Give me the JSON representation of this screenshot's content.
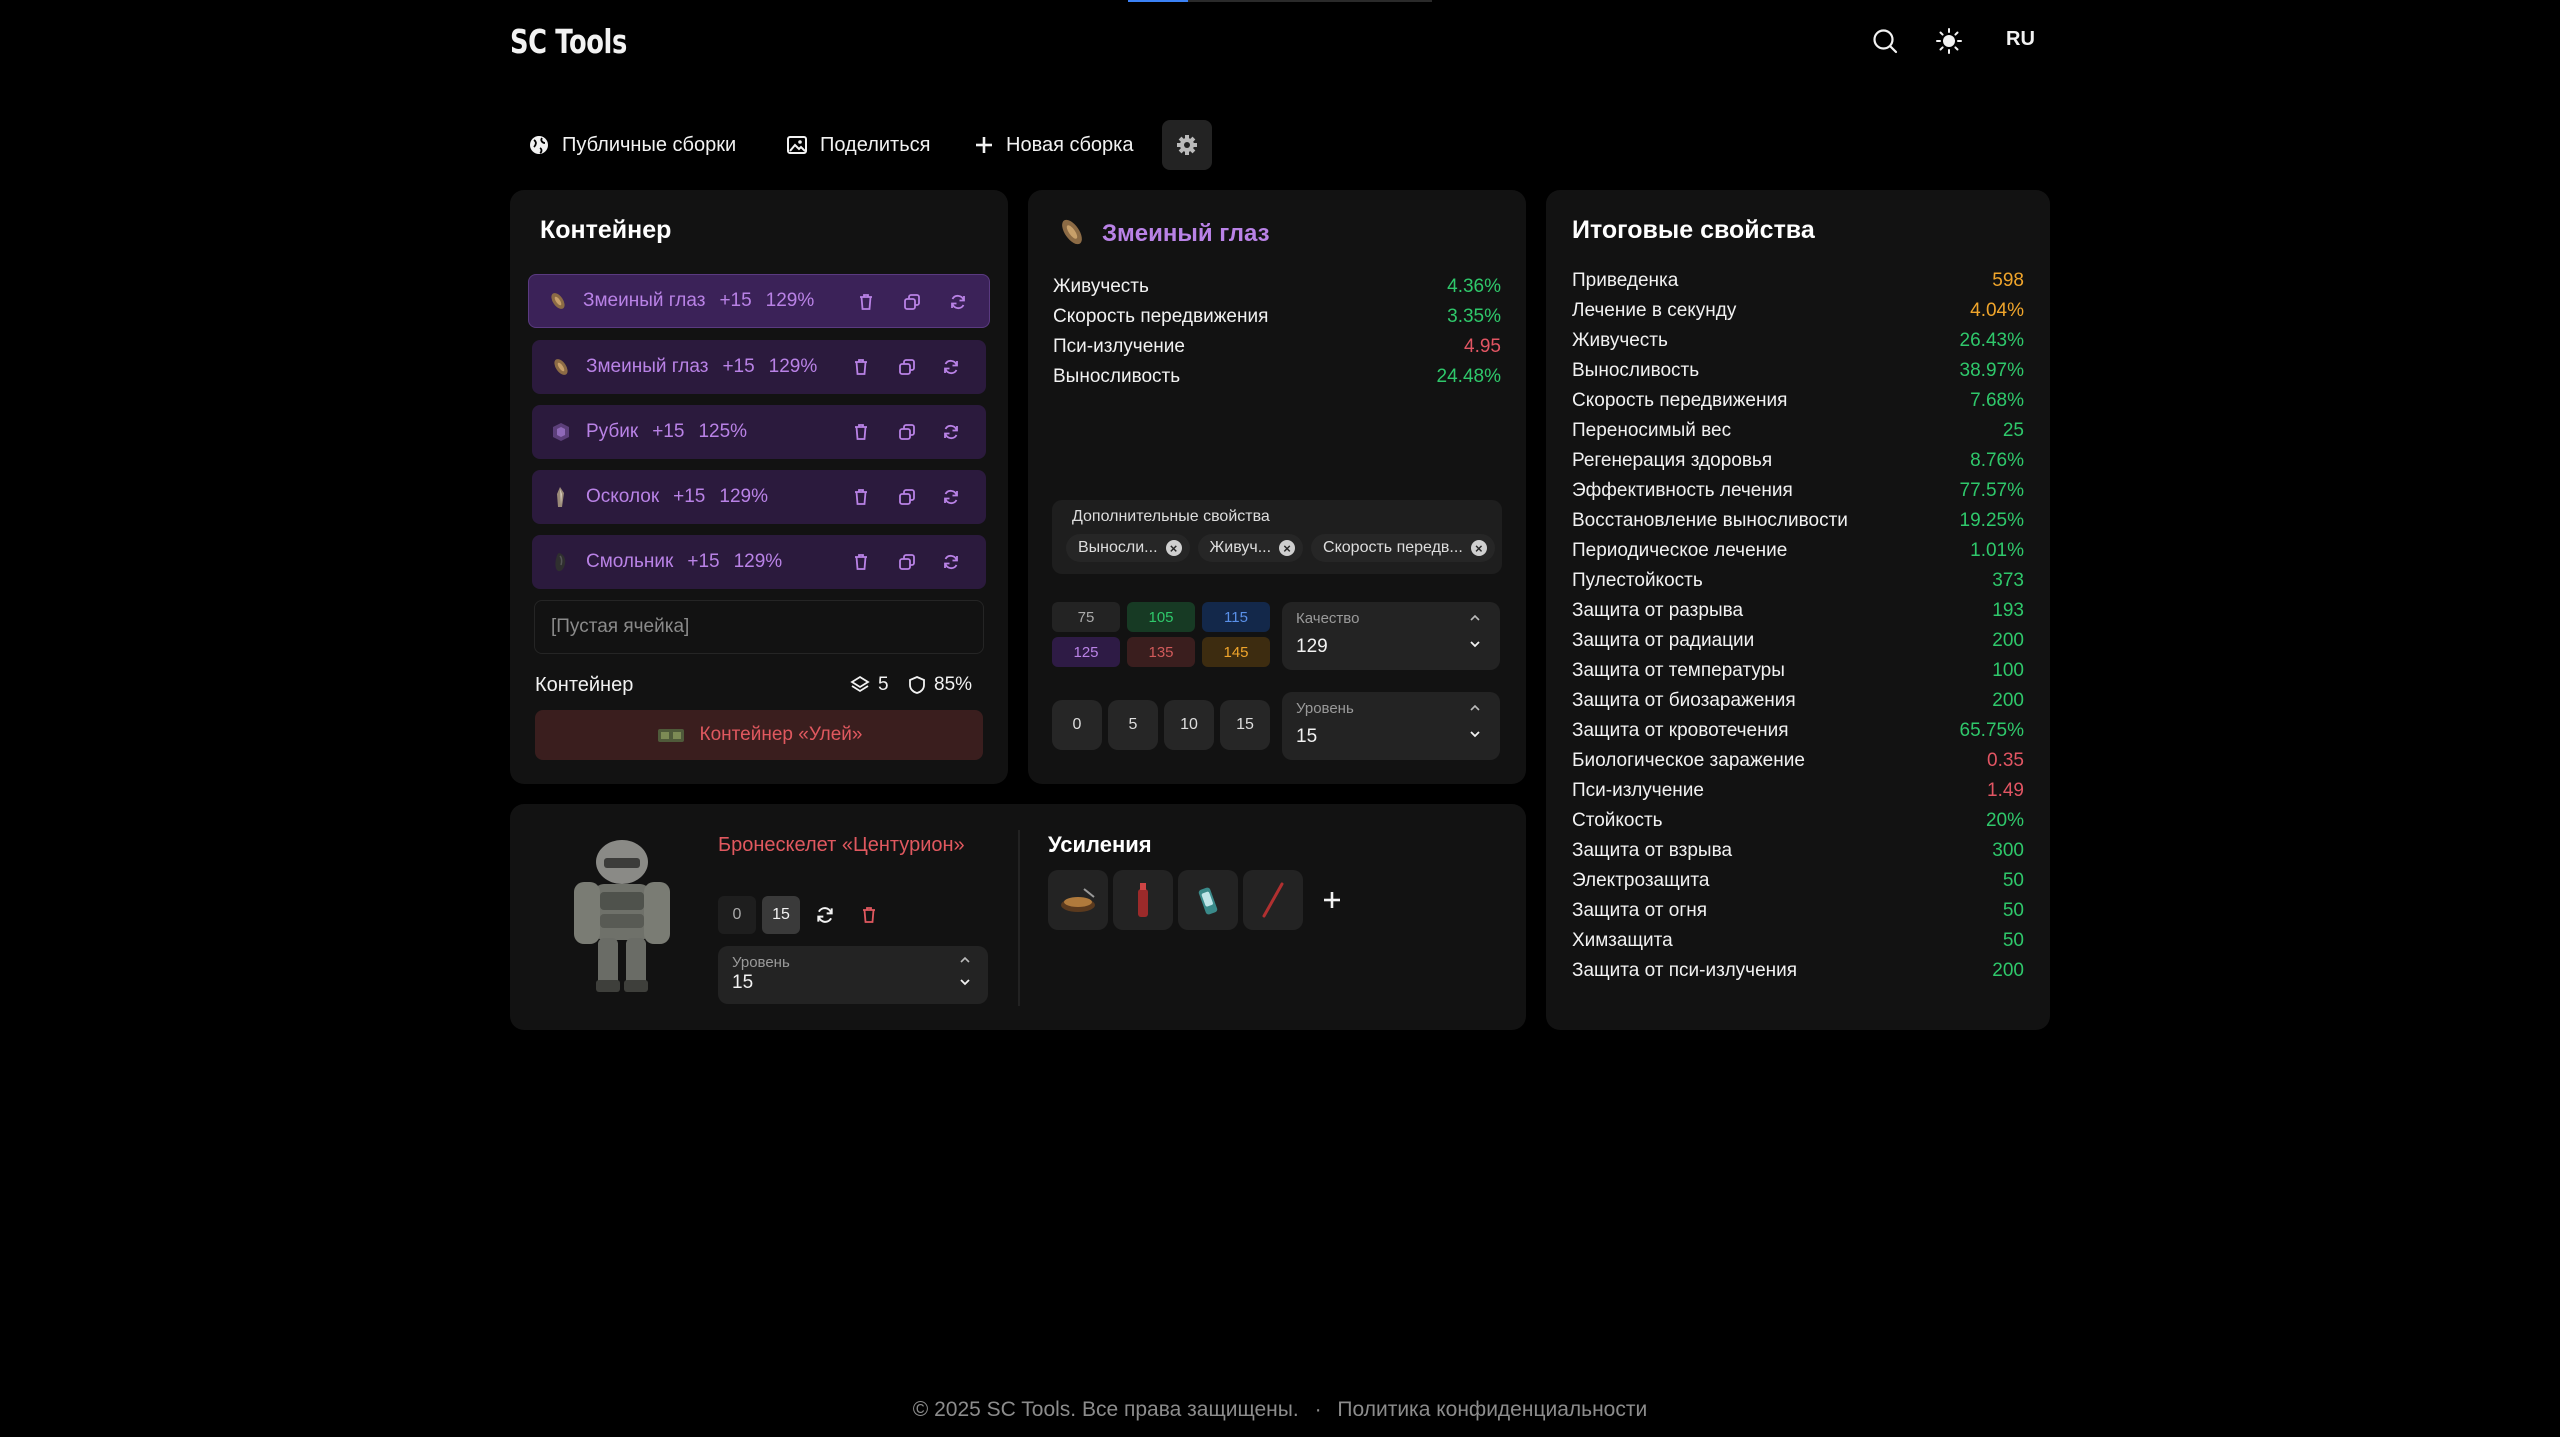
{
  "header": {
    "logo": "SC Tools",
    "lang": "RU"
  },
  "toolbar": {
    "public_builds": "Публичные сборки",
    "share": "Поделиться",
    "new_build": "Новая сборка"
  },
  "container_panel": {
    "title": "Контейнер",
    "slots": [
      {
        "name": "Змеиный глаз",
        "level": "+15",
        "percent": "129%"
      },
      {
        "name": "Змеиный глаз",
        "level": "+15",
        "percent": "129%"
      },
      {
        "name": "Рубик",
        "level": "+15",
        "percent": "125%"
      },
      {
        "name": "Осколок",
        "level": "+15",
        "percent": "129%"
      },
      {
        "name": "Смольник",
        "level": "+15",
        "percent": "129%"
      }
    ],
    "empty_slot": "[Пустая ячейка]",
    "footer_label": "Контейнер",
    "capacity": "5",
    "protection": "85%",
    "container_button": "Контейнер «Улей»"
  },
  "artifact_panel": {
    "title": "Змеиный глаз",
    "stats": [
      {
        "label": "Живучесть",
        "value": "4.36%"
      },
      {
        "label": "Скорость передвижения",
        "value": "3.35%"
      },
      {
        "label": "Пси-излучение",
        "value": "4.95"
      },
      {
        "label": "Выносливость",
        "value": "24.48%"
      }
    ],
    "extra_title": "Дополнительные свойства",
    "chips": [
      "Выносли...",
      "Живуч...",
      "Скорость передв..."
    ],
    "quality_buttons": [
      "75",
      "105",
      "115",
      "125",
      "135",
      "145"
    ],
    "quality_label": "Качество",
    "quality_value": "129",
    "level_buttons": [
      "0",
      "5",
      "10",
      "15"
    ],
    "level_label": "Уровень",
    "level_value": "15"
  },
  "armor_panel": {
    "name": "Бронескелет «Центурион»",
    "level_buttons": [
      "0",
      "15"
    ],
    "level_label": "Уровень",
    "level_value": "15",
    "boosts_title": "Усиления"
  },
  "totals_panel": {
    "title": "Итоговые свойства",
    "rows": [
      {
        "label": "Приведенка",
        "value": "598"
      },
      {
        "label": "Лечение в секунду",
        "value": "4.04%"
      },
      {
        "label": "Живучесть",
        "value": "26.43%"
      },
      {
        "label": "Выносливость",
        "value": "38.97%"
      },
      {
        "label": "Скорость передвижения",
        "value": "7.68%"
      },
      {
        "label": "Переносимый вес",
        "value": "25"
      },
      {
        "label": "Регенерация здоровья",
        "value": "8.76%"
      },
      {
        "label": "Эффективность лечения",
        "value": "77.57%"
      },
      {
        "label": "Восстановление выносливости",
        "value": "19.25%"
      },
      {
        "label": "Периодическое лечение",
        "value": "1.01%"
      },
      {
        "label": "Пулестойкость",
        "value": "373"
      },
      {
        "label": "Защита от разрыва",
        "value": "193"
      },
      {
        "label": "Защита от радиации",
        "value": "200"
      },
      {
        "label": "Защита от температуры",
        "value": "100"
      },
      {
        "label": "Защита от биозаражения",
        "value": "200"
      },
      {
        "label": "Защита от кровотечения",
        "value": "65.75%"
      },
      {
        "label": "Биологическое заражение",
        "value": "0.35"
      },
      {
        "label": "Пси-излучение",
        "value": "1.49"
      },
      {
        "label": "Стойкость",
        "value": "20%"
      },
      {
        "label": "Защита от взрыва",
        "value": "300"
      },
      {
        "label": "Электрозащита",
        "value": "50"
      },
      {
        "label": "Защита от огня",
        "value": "50"
      },
      {
        "label": "Химзащита",
        "value": "50"
      },
      {
        "label": "Защита от пси-излучения",
        "value": "200"
      }
    ]
  },
  "footer": {
    "copyright": "© 2025 SC Tools. Все права защищены.",
    "separator": "·",
    "privacy": "Политика конфиденциальности"
  },
  "colors": {
    "green": "#2fc86b",
    "red": "#e25563",
    "orange": "#f0a52b",
    "purple": "#b982e6"
  }
}
